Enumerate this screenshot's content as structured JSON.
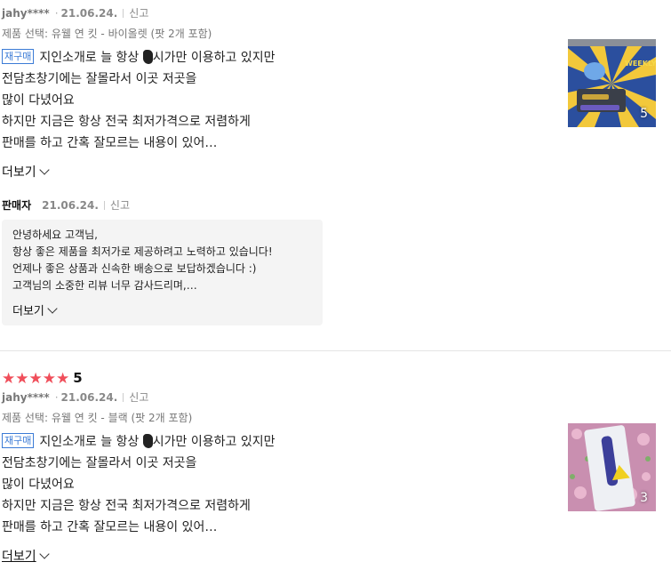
{
  "review1": {
    "user": "jahy****",
    "date": "21.06.24.",
    "report": "신고",
    "option": "제품 선택: 유웰 연 킷 - 바이올렛 (팟 2개 포함)",
    "badge": "재구매",
    "lines": [
      {
        "before": "지인소개로 늘 항상 ",
        "after": "시가만 이용하고 있지만"
      },
      {
        "text": "전담초창기에는 잘몰라서 이곳 저곳을"
      },
      {
        "text": "많이 다녔어요"
      },
      {
        "text": "하지만 지금은 항상 전국 최저가격으로 저렴하게"
      },
      {
        "text": "판매를 하고 간혹 잘모르는 내용이 있어…"
      }
    ],
    "more": "더보기",
    "photo_count": "5",
    "photo_banner": "WEEKLY FANS EVENT"
  },
  "seller_reply": {
    "seller": "판매자",
    "date": "21.06.24.",
    "report": "신고",
    "lines": [
      "안녕하세요 고객님,",
      "항상 좋은 제품을 최저가로 제공하려고 노력하고 있습니다!",
      "언제나 좋은 상품과 신속한 배송으로 보답하겠습니다 :)",
      "고객님의 소중한 리뷰 너무 감사드리며,…"
    ],
    "more": "더보기"
  },
  "review2": {
    "rating": "5",
    "star_count": 5,
    "star_color": "#f04e5a",
    "user": "jahy****",
    "date": "21.06.24.",
    "report": "신고",
    "option": "제품 선택: 유웰 연 킷 - 블랙 (팟 2개 포함)",
    "badge": "재구매",
    "lines": [
      {
        "before": "지인소개로 늘 항상 ",
        "after": "시가만 이용하고 있지만"
      },
      {
        "text": "전담초창기에는 잘몰라서 이곳 저곳을"
      },
      {
        "text": "많이 다녔어요"
      },
      {
        "text": "하지만 지금은 항상 전국 최저가격으로 저렴하게"
      },
      {
        "text": "판매를 하고 간혹 잘모르는 내용이 있어…"
      }
    ],
    "more": "더보기",
    "photo_count": "3"
  }
}
